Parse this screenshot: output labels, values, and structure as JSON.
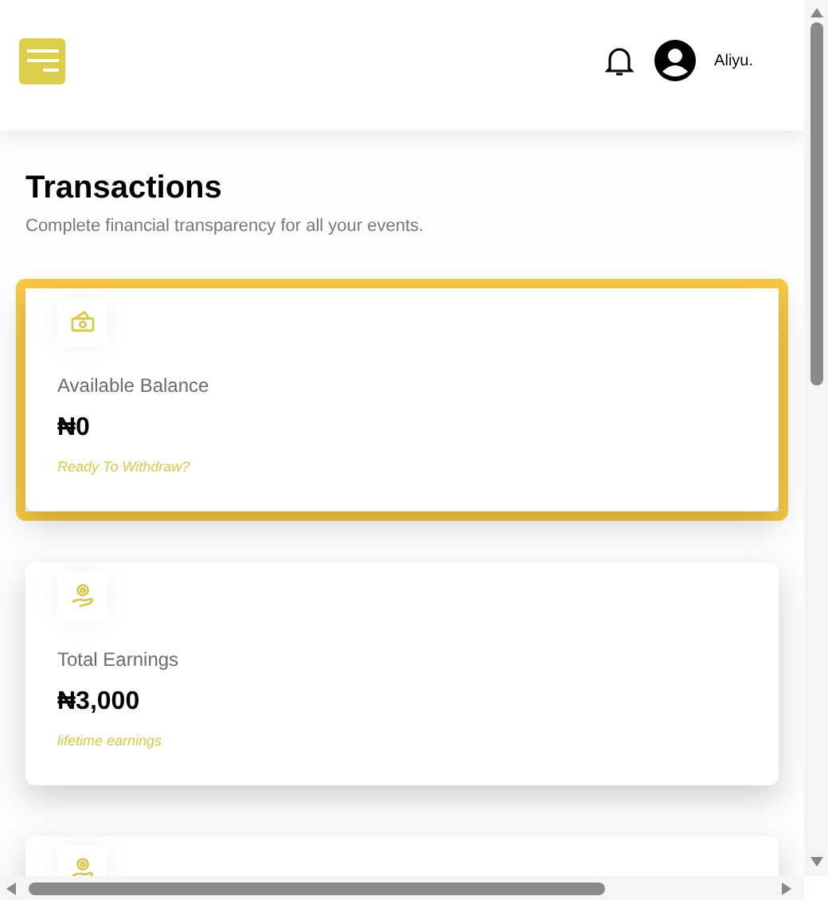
{
  "header": {
    "user_name": "Aliyu."
  },
  "page": {
    "title": "Transactions",
    "subtitle": "Complete financial transparency for all your events."
  },
  "cards": [
    {
      "kind": "cash",
      "selected": true,
      "label": "Available Balance",
      "amount": "₦0",
      "note": "Ready To Withdraw?"
    },
    {
      "kind": "earnings",
      "selected": false,
      "label": "Total Earnings",
      "amount": "₦3,000",
      "note": "lifetime earnings"
    },
    {
      "kind": "earnings",
      "selected": false
    }
  ]
}
